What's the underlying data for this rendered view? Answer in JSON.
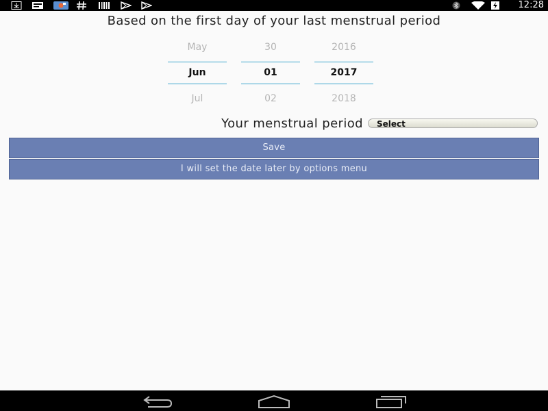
{
  "status_bar": {
    "time": "12:28",
    "left_icons": [
      "download-icon",
      "message-icon",
      "app-photo-icon",
      "hash-icon",
      "barcode-icon",
      "play-store-icon",
      "play-store-icon"
    ],
    "right_icons": [
      "bluetooth-icon",
      "wifi-icon",
      "battery-charging-icon"
    ]
  },
  "title": "Based on the first day of your last menstrual period",
  "date_picker": {
    "month": {
      "prev": "May",
      "current": "Jun",
      "next": "Jul"
    },
    "day": {
      "prev": "30",
      "current": "01",
      "next": "02"
    },
    "year": {
      "prev": "2016",
      "current": "2017",
      "next": "2018"
    }
  },
  "period": {
    "label": "Your menstrual period",
    "select_value": "Select"
  },
  "buttons": {
    "save": "Save",
    "later": "I will set the date later by options menu"
  },
  "nav_bar": {
    "icons": [
      "back-icon",
      "home-icon",
      "recents-icon"
    ]
  },
  "colors": {
    "accent_line": "#3aa5cd",
    "button_bg": "#6a7fb3",
    "background": "#fafafa"
  }
}
